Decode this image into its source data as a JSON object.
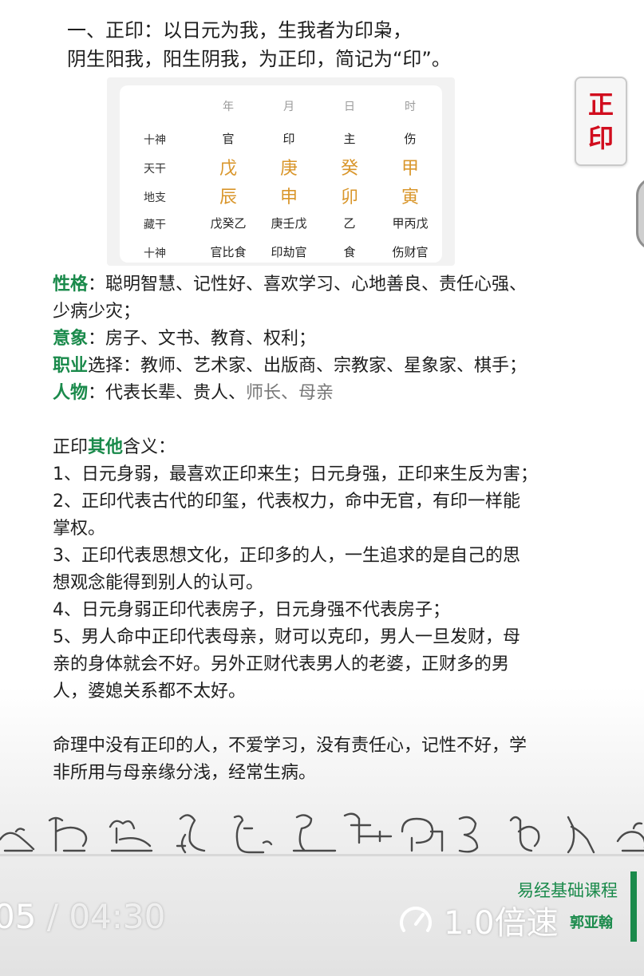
{
  "intro": {
    "line1": "一、正印：以日元为我，生我者为印枭，",
    "line2": "阴生阳我，阳生阴我，为正印，简记为“印”。"
  },
  "table": {
    "columns": [
      "年",
      "月",
      "日",
      "时"
    ],
    "rows": [
      {
        "label": "十神",
        "cells": [
          "官",
          "印",
          "主",
          "伤"
        ]
      },
      {
        "label": "天干",
        "cells": [
          "戊",
          "庚",
          "癸",
          "甲"
        ]
      },
      {
        "label": "地支",
        "cells": [
          "辰",
          "申",
          "卯",
          "寅"
        ]
      },
      {
        "label": "藏干",
        "cells": [
          "戊癸乙",
          "庚壬戊",
          "乙",
          "甲丙戊"
        ]
      },
      {
        "label": "十神",
        "cells": [
          "官比食",
          "印劫官",
          "食",
          "伤财官"
        ]
      }
    ]
  },
  "stamp": {
    "char1": "正",
    "char2": "印"
  },
  "traits": {
    "personality_label": "性格",
    "personality_text": "：聪明智慧、记性好、喜欢学习、心地善良、责任心强、",
    "personality_text2": "少病少灾；",
    "imagery_label": "意象",
    "imagery_text": "：房子、文书、教育、权利；",
    "career_label": "职业",
    "career_text": "选择：教师、艺术家、出版商、宗教家、星象家、棋手；",
    "people_label": "人物",
    "people_text": "：代表长辈、贵人、",
    "people_text_grey": "师长、母亲"
  },
  "other": {
    "title_prefix": "正印",
    "title_green": "其他",
    "title_suffix": "含义：",
    "lines": [
      "1、日元身弱，最喜欢正印来生；日元身强，正印来生反为害；",
      "2、正印代表古代的印玺，代表权力，命中无官，有印一样能",
      "掌权。",
      "3、正印代表思想文化，正印多的人，一生追求的是自己的思",
      "想观念能得到别人的认可。",
      "4、日元身弱正印代表房子，日元身强不代表房子；",
      "5、男人命中正印代表母亲，财可以克印，男人一旦发财，母",
      "亲的身体就会不好。另外正财代表男人的老婆，正财多的男",
      "人，婆媳关系都不太好。"
    ]
  },
  "summary": {
    "line1": "命理中没有正印的人，不爱学习，没有责任心，记性不好，学",
    "line2": "非所用与母亲缘分浅，经常生病。"
  },
  "player": {
    "current_time": "05",
    "separator": " / ",
    "total_time": "04:30",
    "speed": "1.0倍速"
  },
  "branding": {
    "course": "易经基础课程",
    "author": "郭亚翰"
  }
}
